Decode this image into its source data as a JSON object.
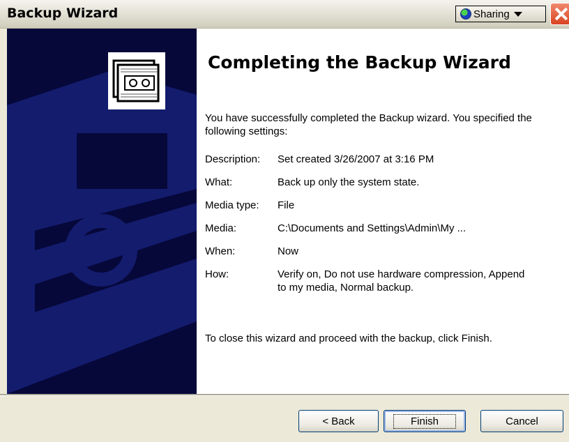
{
  "window": {
    "title": "Backup Wizard"
  },
  "titlebar": {
    "sharing_label": "Sharing"
  },
  "page": {
    "heading": "Completing the Backup Wizard",
    "intro": "You have successfully completed the Backup wizard. You specified the following settings:",
    "settings": [
      {
        "label": "Description:",
        "value": "Set created 3/26/2007 at 3:16 PM"
      },
      {
        "label": "What:",
        "value": "Back up only the system state."
      },
      {
        "label": "Media type:",
        "value": "File"
      },
      {
        "label": "Media:",
        "value": "C:\\Documents and Settings\\Admin\\My ..."
      },
      {
        "label": "When:",
        "value": "Now"
      },
      {
        "label": "How:",
        "value": "Verify on, Do not use hardware compression, Append to my media, Normal backup."
      }
    ],
    "outro": "To close this wizard and proceed with the backup, click Finish."
  },
  "buttons": {
    "back": "< Back",
    "finish": "Finish",
    "cancel": "Cancel"
  },
  "colors": {
    "banner": "#06083a",
    "banner_shape": "#141c6e",
    "title_bar": "#e1dfd2",
    "close": "#d84322"
  }
}
